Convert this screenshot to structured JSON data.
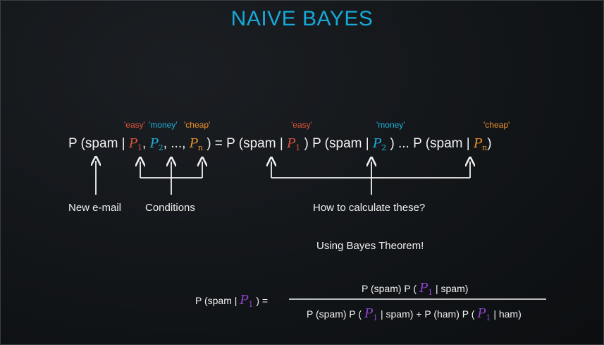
{
  "title": "NAIVE BAYES",
  "tags": {
    "easy": "'easy'",
    "money": "'money'",
    "cheap": "'cheap'"
  },
  "equation": {
    "lhs_prefix": "P (spam |",
    "p": "P",
    "sub1": "1",
    "sub2": "2",
    "subn": "n",
    "comma": ",",
    "ellipsis": ", ...,",
    "close_eq": ") = P (spam |",
    "close_p": ") P (spam |",
    "close_dots": ") ... P (spam |",
    "close": ")"
  },
  "labels": {
    "new_email": "New e-mail",
    "conditions": "Conditions",
    "how_to": "How to calculate these?",
    "using_bayes": "Using Bayes Theorem!"
  },
  "formula": {
    "lhs_prefix": "P (spam |",
    "lhs_suffix": ") =",
    "numerator_a": "P (spam) P (",
    "numerator_b": "| spam)",
    "denominator_a": "P (spam) P (",
    "denominator_b": "| spam) + P (ham) P (",
    "denominator_c": "| ham)"
  },
  "colors": {
    "title": "#17a8d8",
    "easy": "#e0553b",
    "money": "#1fb3df",
    "cheap": "#f0922c",
    "bayes_var": "#8e44d0"
  }
}
